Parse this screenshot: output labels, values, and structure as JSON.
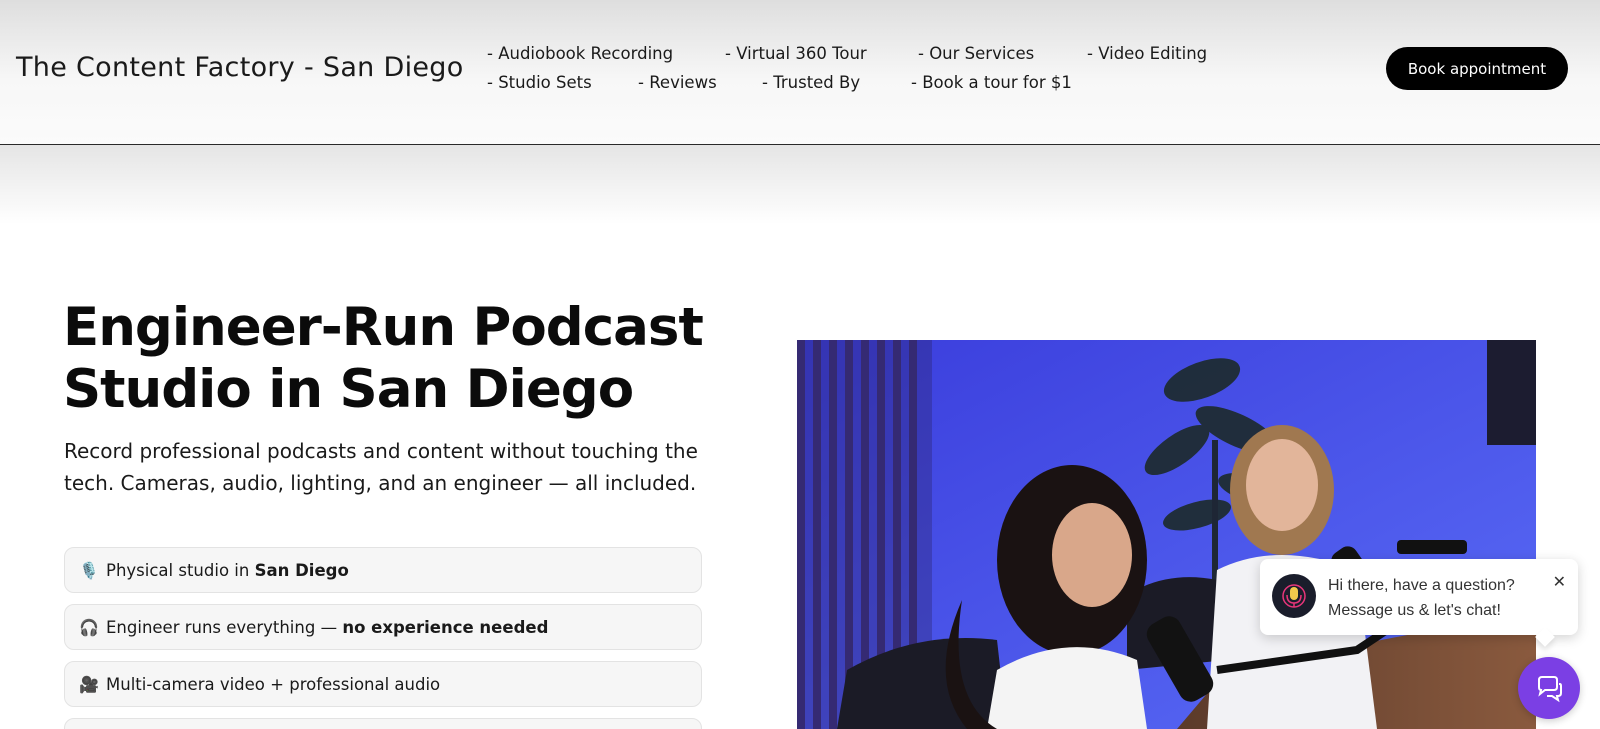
{
  "header": {
    "brand": "The Content Factory - San Diego",
    "nav": [
      "- Audiobook Recording",
      "- Virtual 360 Tour",
      "- Our Services",
      "- Video Editing",
      "- Studio Sets",
      "- Reviews",
      "- Trusted By",
      "- Book a tour for $1"
    ],
    "cta_label": "Book appointment"
  },
  "hero": {
    "title_line1": "Engineer-Run Podcast",
    "title_line2": "Studio in San Diego",
    "subtitle": "Record professional podcasts and content without touching the tech. Cameras, audio, lighting, and an engineer — all included.",
    "features": [
      {
        "icon": "🎙️",
        "text": "Physical studio in ",
        "bold": "San Diego"
      },
      {
        "icon": "🎧",
        "text": "Engineer runs everything — ",
        "bold": "no experience needed"
      },
      {
        "icon": "🎥",
        "text": "Multi-camera video + professional audio",
        "bold": ""
      }
    ]
  },
  "chat": {
    "line1": "Hi there, have a question?",
    "line2": "Message us & let's chat!",
    "close": "✕"
  },
  "colors": {
    "cta_bg": "#000000",
    "launcher": "#7b3fe4",
    "photo_blue": "#4a57f2"
  }
}
